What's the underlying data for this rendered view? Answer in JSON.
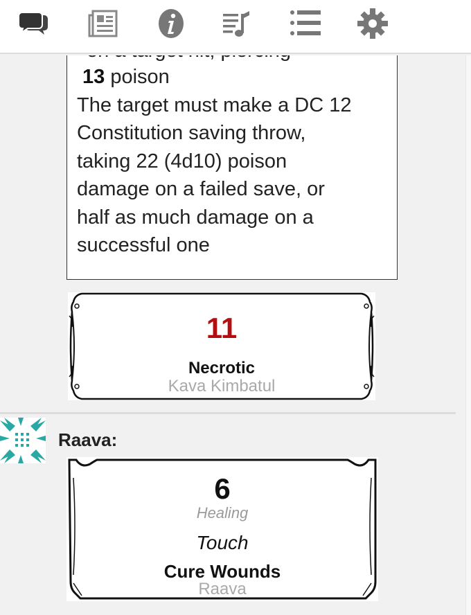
{
  "toolbar": {
    "icons": [
      {
        "name": "chat-icon",
        "label": "Chat",
        "active": true
      },
      {
        "name": "journal-icon",
        "label": "Journal",
        "active": false
      },
      {
        "name": "info-icon",
        "label": "Compendium",
        "active": false
      },
      {
        "name": "jukebox-icon",
        "label": "Jukebox",
        "active": false
      },
      {
        "name": "collections-icon",
        "label": "Collections",
        "active": false
      },
      {
        "name": "settings-icon",
        "label": "Settings",
        "active": false
      }
    ],
    "active_color": "#333333",
    "inactive_color": "#777777"
  },
  "chat": {
    "description_card": {
      "clipped_top_line": "on a target hit, piercing",
      "damage_amount": "13",
      "damage_type": "poison",
      "lines": [
        "The target must make a DC 12",
        "Constitution saving throw,",
        "taking 22 (4d10) poison",
        "damage on a failed save, or",
        "half as much damage on a",
        "successful one"
      ]
    },
    "necrotic_roll": {
      "value": "11",
      "value_color": "#b30f12",
      "type": "Necrotic",
      "source": "Kava Kimbatul"
    },
    "message": {
      "speaker": "Raava:",
      "avatar_color": "#2aa8a4",
      "heal_roll": {
        "value": "6",
        "type": "Healing",
        "range": "Touch",
        "spell_name": "Cure Wounds",
        "source": "Raava"
      }
    }
  }
}
